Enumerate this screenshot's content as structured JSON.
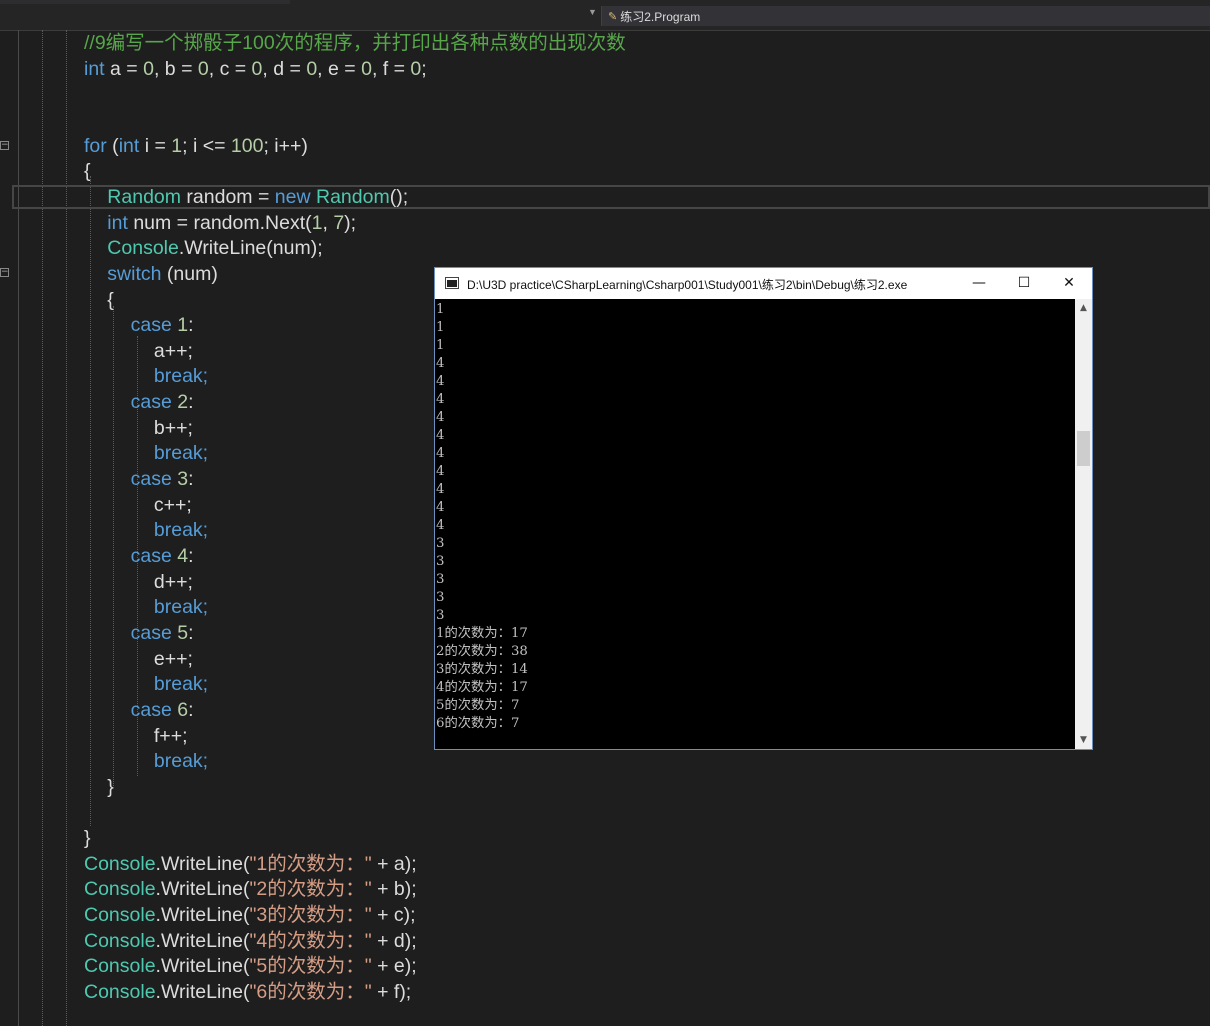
{
  "editor": {
    "nav_member": "练习2.Program",
    "nav_member_icon": "class-member-icon"
  },
  "code": {
    "l1": "//9编写一个掷骰子100次的程序，并打印出各种点数的出现次数",
    "l2": [
      [
        "int",
        "kw"
      ],
      [
        " a = ",
        ""
      ],
      [
        "0",
        "num"
      ],
      [
        ", b = ",
        ""
      ],
      [
        "0",
        "num"
      ],
      [
        ", c = ",
        ""
      ],
      [
        "0",
        "num"
      ],
      [
        ", d = ",
        ""
      ],
      [
        "0",
        "num"
      ],
      [
        ", e = ",
        ""
      ],
      [
        "0",
        "num"
      ],
      [
        ", f = ",
        ""
      ],
      [
        "0",
        "num"
      ],
      [
        ";",
        ""
      ]
    ],
    "l3": [
      [
        "for",
        "kw"
      ],
      [
        " (",
        ""
      ],
      [
        "int",
        "kw"
      ],
      [
        " i = ",
        ""
      ],
      [
        "1",
        "num"
      ],
      [
        "; i <= ",
        ""
      ],
      [
        "100",
        "num"
      ],
      [
        "; i++)",
        ""
      ]
    ],
    "l4": "{",
    "l5": [
      [
        "Random",
        "ty"
      ],
      [
        " random = ",
        ""
      ],
      [
        "new",
        "kw"
      ],
      [
        " ",
        ""
      ],
      [
        "Random",
        "ty"
      ],
      [
        "();",
        ""
      ]
    ],
    "l6": [
      [
        "int",
        "kw"
      ],
      [
        " num = random.Next(",
        ""
      ],
      [
        "1",
        "num"
      ],
      [
        ", ",
        ""
      ],
      [
        "7",
        "num"
      ],
      [
        ");",
        ""
      ]
    ],
    "l7": [
      [
        "Console",
        "ty"
      ],
      [
        ".WriteLine(num);",
        ""
      ]
    ],
    "l8": [
      [
        "switch",
        "kw"
      ],
      [
        " (num)",
        ""
      ]
    ],
    "l9": "{",
    "cases": [
      {
        "case": [
          [
            "case",
            "kw"
          ],
          [
            " ",
            ""
          ],
          [
            "1",
            "num"
          ],
          [
            ":",
            ""
          ]
        ],
        "inc": "a++;",
        "brk": "break;"
      },
      {
        "case": [
          [
            "case",
            "kw"
          ],
          [
            " ",
            ""
          ],
          [
            "2",
            "num"
          ],
          [
            ":",
            ""
          ]
        ],
        "inc": "b++;",
        "brk": "break;"
      },
      {
        "case": [
          [
            "case",
            "kw"
          ],
          [
            " ",
            ""
          ],
          [
            "3",
            "num"
          ],
          [
            ":",
            ""
          ]
        ],
        "inc": "c++;",
        "brk": "break;"
      },
      {
        "case": [
          [
            "case",
            "kw"
          ],
          [
            " ",
            ""
          ],
          [
            "4",
            "num"
          ],
          [
            ":",
            ""
          ]
        ],
        "inc": "d++;",
        "brk": "break;"
      },
      {
        "case": [
          [
            "case",
            "kw"
          ],
          [
            " ",
            ""
          ],
          [
            "5",
            "num"
          ],
          [
            ":",
            ""
          ]
        ],
        "inc": "e++;",
        "brk": "break;"
      },
      {
        "case": [
          [
            "case",
            "kw"
          ],
          [
            " ",
            ""
          ],
          [
            "6",
            "num"
          ],
          [
            ":",
            ""
          ]
        ],
        "inc": "f++;",
        "brk": "break;"
      }
    ],
    "switch_close": "}",
    "for_close": "}",
    "writelines": [
      [
        [
          "Console",
          "ty"
        ],
        [
          ".WriteLine(",
          ""
        ],
        [
          "\"1的次数为：\"",
          "str"
        ],
        [
          " + a);",
          ""
        ]
      ],
      [
        [
          "Console",
          "ty"
        ],
        [
          ".WriteLine(",
          ""
        ],
        [
          "\"2的次数为：\"",
          "str"
        ],
        [
          " + b);",
          ""
        ]
      ],
      [
        [
          "Console",
          "ty"
        ],
        [
          ".WriteLine(",
          ""
        ],
        [
          "\"3的次数为：\"",
          "str"
        ],
        [
          " + c);",
          ""
        ]
      ],
      [
        [
          "Console",
          "ty"
        ],
        [
          ".WriteLine(",
          ""
        ],
        [
          "\"4的次数为：\"",
          "str"
        ],
        [
          " + d);",
          ""
        ]
      ],
      [
        [
          "Console",
          "ty"
        ],
        [
          ".WriteLine(",
          ""
        ],
        [
          "\"5的次数为：\"",
          "str"
        ],
        [
          " + e);",
          ""
        ]
      ],
      [
        [
          "Console",
          "ty"
        ],
        [
          ".WriteLine(",
          ""
        ],
        [
          "\"6的次数为：\"",
          "str"
        ],
        [
          " + f);",
          ""
        ]
      ]
    ]
  },
  "console": {
    "title": "D:\\U3D practice\\CSharpLearning\\Csharp001\\Study001\\练习2\\bin\\Debug\\练习2.exe",
    "minimize": "—",
    "maximize": "☐",
    "close": "✕",
    "output_lines": [
      "1",
      "1",
      "1",
      "4",
      "4",
      "4",
      "4",
      "4",
      "4",
      "4",
      "4",
      "4",
      "4",
      "3",
      "3",
      "3",
      "3",
      "3",
      "1的次数为：17",
      "2的次数为：38",
      "3的次数为：14",
      "4的次数为：17",
      "5的次数为：7",
      "6的次数为：7"
    ]
  }
}
